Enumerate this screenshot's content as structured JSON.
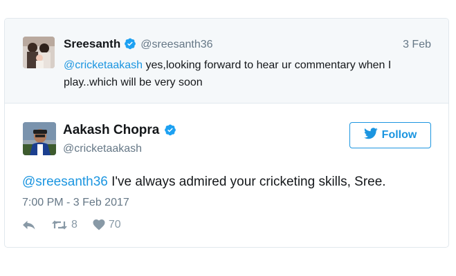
{
  "parent_tweet": {
    "name": "Sreesanth",
    "handle": "@sreesanth36",
    "date": "3 Feb",
    "mention": "@cricketaakash",
    "text": " yes,looking forward to hear ur commentary when I play..which will be very soon"
  },
  "main_tweet": {
    "name": "Aakash Chopra",
    "handle": "@cricketaakash",
    "follow_label": "Follow",
    "mention": "@sreesanth36",
    "text": " I've always admired your cricketing skills, Sree.",
    "timestamp": "7:00 PM - 3 Feb 2017",
    "retweet_count": "8",
    "like_count": "70"
  },
  "colors": {
    "accent": "#1b95e0",
    "muted": "#657786",
    "parent_bg": "#f5f8fa",
    "border": "#e1e8ed"
  },
  "icons": {
    "verified": "verified-badge-icon",
    "bird": "twitter-bird-icon",
    "reply": "reply-icon",
    "retweet": "retweet-icon",
    "like": "heart-icon"
  }
}
